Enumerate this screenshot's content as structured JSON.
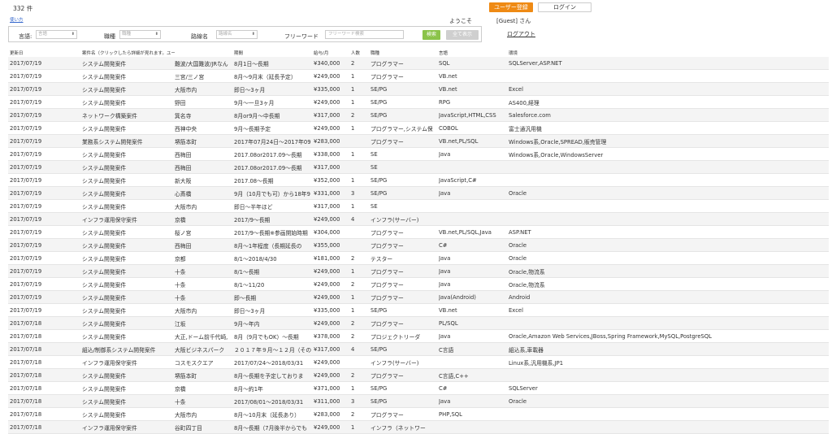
{
  "header": {
    "count": "332 件",
    "help_link": "使い方",
    "register_button": "ユーザー登録",
    "login_button": "ログイン",
    "welcome": "ようこそ",
    "guest": "[Guest] さん",
    "logout": "ログアウト"
  },
  "search": {
    "language_label": "言語",
    "language_value": "言語",
    "duty_label": "職種",
    "duty_value": "職種",
    "line_label": "路線名",
    "line_value": "路線名",
    "freeword_label": "フリーワード",
    "freeword_placeholder": "フリーワード検索",
    "search_button": "検索",
    "show_all_button": "全て表示"
  },
  "table": {
    "columns": [
      "更新日",
      "案件名（クリックしたら詳細が見れます。ユーザーのみ）",
      "",
      "期間",
      "給与/月",
      "人数",
      "職種",
      "言語",
      "環境"
    ],
    "rows": [
      [
        "2017/07/19",
        "システム開発案件",
        "難波/大国難波/JRなん",
        "8月1日～長期",
        "¥340,000",
        "2",
        "プログラマー",
        "SQL",
        "SQLServer,ASP.NET"
      ],
      [
        "2017/07/19",
        "システム開発案件",
        "三宮/三ノ宮",
        "8月～9月末（延長予定）",
        "¥249,000",
        "1",
        "プログラマー",
        "VB.net",
        ""
      ],
      [
        "2017/07/19",
        "システム開発案件",
        "大阪市内",
        "即日～3ヶ月",
        "¥335,000",
        "1",
        "SE/PG",
        "VB.net",
        "Excel"
      ],
      [
        "2017/07/19",
        "システム開発案件",
        "野田",
        "9月～一旦3ヶ月",
        "¥249,000",
        "1",
        "SE/PG",
        "RPG",
        "AS400,経理"
      ],
      [
        "2017/07/19",
        "ネットワーク構築案件",
        "箕名寺",
        "8月or9月～中長期",
        "¥317,000",
        "2",
        "SE/PG",
        "JavaScript,HTML,CSS",
        "Salesforce.com"
      ],
      [
        "2017/07/19",
        "システム開発案件",
        "西神中央",
        "9月～長期予定",
        "¥249,000",
        "1",
        "プログラマー,システム保",
        "COBOL",
        "富士通汎用機"
      ],
      [
        "2017/07/19",
        "業務系システム開発案件",
        "堺筋本町",
        "2017年07月24日～2017年09",
        "¥283,000",
        "",
        "プログラマー",
        "VB.net,PL/SQL",
        "Windows系,Oracle,SPREAD,販売管理"
      ],
      [
        "2017/07/19",
        "システム開発案件",
        "西梅田",
        "2017.08or2017.09～長期",
        "¥338,000",
        "1",
        "SE",
        "Java",
        "Windows系,Oracle,WindowsServer"
      ],
      [
        "2017/07/19",
        "システム開発案件",
        "西梅田",
        "2017.08or2017.09～長期",
        "¥317,000",
        "",
        "SE",
        "",
        ""
      ],
      [
        "2017/07/19",
        "システム開発案件",
        "新大阪",
        "2017.08～長期",
        "¥352,000",
        "1",
        "SE/PG",
        "JavaScript,C#",
        ""
      ],
      [
        "2017/07/19",
        "システム開発案件",
        "心斎橋",
        "9月（10月でも可）から18年9",
        "¥331,000",
        "3",
        "SE/PG",
        "Java",
        "Oracle"
      ],
      [
        "2017/07/19",
        "システム開発案件",
        "大阪市内",
        "即日～半年ほど",
        "¥317,000",
        "1",
        "SE",
        "",
        ""
      ],
      [
        "2017/07/19",
        "インフラ運用保守案件",
        "京橋",
        "2017/9～長期",
        "¥249,000",
        "4",
        "インフラ(サーバー)",
        "",
        ""
      ],
      [
        "2017/07/19",
        "システム開発案件",
        "桜ノ宮",
        "2017/9～長期※参画開始時期",
        "¥304,000",
        "",
        "プログラマー",
        "VB.net,PL/SQL,Java",
        "ASP.NET"
      ],
      [
        "2017/07/19",
        "システム開発案件",
        "西梅田",
        "8月～1年程度（長期延長の",
        "¥355,000",
        "",
        "プログラマー",
        "C#",
        "Oracle"
      ],
      [
        "2017/07/19",
        "システム開発案件",
        "京都",
        "8/1～2018/4/30",
        "¥181,000",
        "2",
        "テスター",
        "Java",
        "Oracle"
      ],
      [
        "2017/07/19",
        "システム開発案件",
        "十条",
        "8/1～長期",
        "¥249,000",
        "1",
        "プログラマー",
        "Java",
        "Oracle,物流系"
      ],
      [
        "2017/07/19",
        "システム開発案件",
        "十条",
        "8/1～11/20",
        "¥249,000",
        "2",
        "プログラマー",
        "Java",
        "Oracle,物流系"
      ],
      [
        "2017/07/19",
        "システム開発案件",
        "十条",
        "即～長期",
        "¥249,000",
        "1",
        "プログラマー",
        "Java(Android)",
        "Android"
      ],
      [
        "2017/07/19",
        "システム開発案件",
        "大阪市内",
        "即日～3ヶ月",
        "¥335,000",
        "1",
        "SE/PG",
        "VB.net",
        "Excel"
      ],
      [
        "2017/07/18",
        "システム開発案件",
        "江坂",
        "9月～年内",
        "¥249,000",
        "2",
        "プログラマー",
        "PL/SQL",
        ""
      ],
      [
        "2017/07/18",
        "システム開発案件",
        "大正,ドーム前千代崎,",
        "8月（9月でもOK）～長期",
        "¥378,000",
        "2",
        "プロジェクトリーダ",
        "Java",
        "Oracle,Amazon Web Services,JBoss,Spring Framework,MySQL,PostgreSQL"
      ],
      [
        "2017/07/18",
        "組込/制御系システム開発案件",
        "大阪ビジネスパーク",
        "２０１７年９月～１２月（その",
        "¥317,000",
        "4",
        "SE/PG",
        "C言語",
        "組込系,車載器"
      ],
      [
        "2017/07/18",
        "インフラ運用保守案件",
        "コスモスクエア",
        "2017/07/24～2018/03/31",
        "¥249,000",
        "",
        "インフラ(サーバー)",
        "",
        "Linux系,汎用機系,JP1"
      ],
      [
        "2017/07/18",
        "システム開発案件",
        "堺筋本町",
        "8月～長期を予定しておりま",
        "¥249,000",
        "2",
        "プログラマー",
        "C言語,C++",
        ""
      ],
      [
        "2017/07/18",
        "システム開発案件",
        "京橋",
        "8月～約1年",
        "¥371,000",
        "1",
        "SE/PG",
        "C#",
        "SQLServer"
      ],
      [
        "2017/07/18",
        "システム開発案件",
        "十条",
        "2017/08/01～2018/03/31",
        "¥311,000",
        "3",
        "SE/PG",
        "Java",
        "Oracle"
      ],
      [
        "2017/07/18",
        "システム開発案件",
        "大阪市内",
        "8月～10月末（延長あり）",
        "¥283,000",
        "2",
        "プログラマー",
        "PHP,SQL",
        ""
      ],
      [
        "2017/07/18",
        "インフラ運用保守案件",
        "谷町四丁目",
        "8月～長期（7月後半からでも",
        "¥249,000",
        "1",
        "インフラ（ネットワー",
        "",
        ""
      ]
    ]
  }
}
